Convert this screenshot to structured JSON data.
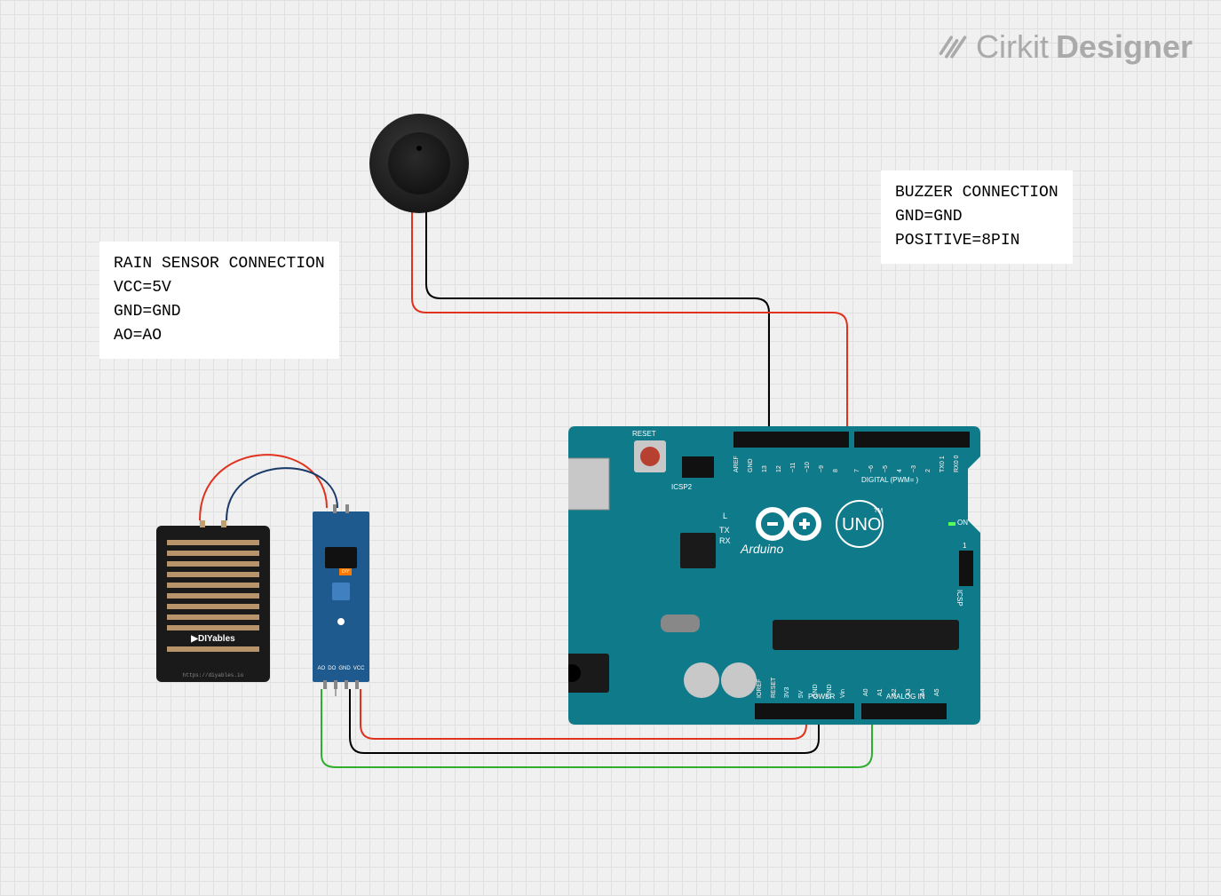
{
  "brand": {
    "part1": "Cirkit",
    "part2": "Designer"
  },
  "notes": {
    "rain_sensor": {
      "title": "RAIN SENSOR CONNECTION",
      "lines": [
        "VCC=5V",
        "GND=GND",
        "AO=AO"
      ]
    },
    "buzzer": {
      "title": "BUZZER CONNECTION",
      "lines": [
        "GND=GND",
        "POSITIVE=8PIN"
      ]
    }
  },
  "components": {
    "buzzer": {
      "name": "Passive Buzzer"
    },
    "rain_plate": {
      "label": "DIYables",
      "footer": "https://diyables.io"
    },
    "rain_module": {
      "pin_labels": [
        "AO",
        "DO",
        "GND",
        "VCC"
      ],
      "diy": "DIY"
    },
    "arduino": {
      "board_name": "Arduino",
      "model": "UNO",
      "tm": "TM",
      "reset": "RESET",
      "icsp2": "ICSP2",
      "icsp": "ICSP",
      "on": "ON",
      "l": "L",
      "tx": "TX",
      "rx": "RX",
      "power_label": "POWER",
      "analog_label": "ANALOG IN",
      "digital_label": "DIGITAL (PWM=   )",
      "top_pins": [
        "AREF",
        "GND",
        "13",
        "12",
        "~11",
        "~10",
        "~9",
        "8",
        "7",
        "~6",
        "~5",
        "4",
        "~3",
        "2",
        "TX0 1",
        "RX0 0"
      ],
      "bottom_left_pins": [
        "IOREF",
        "RESET",
        "3V3",
        "5V",
        "GND",
        "GND",
        "Vin"
      ],
      "bottom_right_pins": [
        "A0",
        "A1",
        "A2",
        "A3",
        "A4",
        "A5"
      ],
      "digital1": "1"
    }
  },
  "connections": {
    "buzzer_positive_to_pin8": {
      "color": "red"
    },
    "buzzer_gnd_to_gnd": {
      "color": "black"
    },
    "rain_vcc_to_5v": {
      "color": "red"
    },
    "rain_gnd_to_gnd": {
      "color": "black"
    },
    "rain_ao_to_a0": {
      "color": "green"
    },
    "rain_plate_to_module_1": {
      "color": "red"
    },
    "rain_plate_to_module_2": {
      "color": "navy"
    }
  }
}
